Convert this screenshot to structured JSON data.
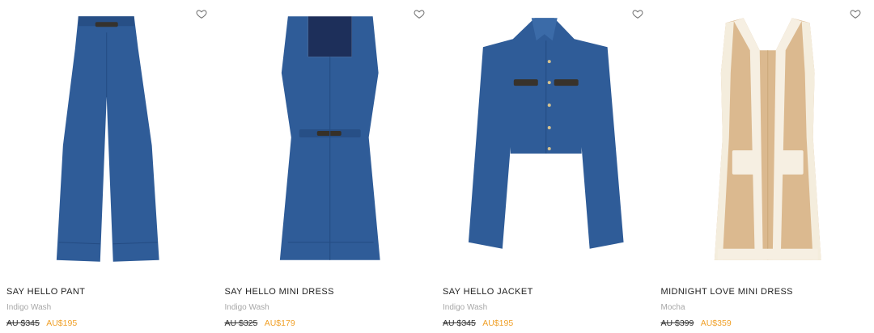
{
  "products": [
    {
      "name": "SAY HELLO PANT",
      "color": "Indigo Wash",
      "price_original": "AU $345",
      "price_sale": "AU$195",
      "image": "denim-wide-leg-pant",
      "swatch": "#2f5c98"
    },
    {
      "name": "SAY HELLO MINI DRESS",
      "color": "Indigo Wash",
      "price_original": "AU $325",
      "price_sale": "AU$179",
      "image": "denim-mini-dress",
      "swatch": "#2f5c98"
    },
    {
      "name": "SAY HELLO JACKET",
      "color": "Indigo Wash",
      "price_original": "AU $345",
      "price_sale": "AU$195",
      "image": "denim-cropped-jacket",
      "swatch": "#2f5c98"
    },
    {
      "name": "MIDNIGHT LOVE MINI DRESS",
      "color": "Mocha",
      "price_original": "AU $399",
      "price_sale": "AU$359",
      "image": "mocha-vest-dress",
      "swatch": "#dbb98f"
    }
  ],
  "icons": {
    "favorite": "heart-outline-icon"
  },
  "colors": {
    "sale": "#f0a028",
    "denim": "#2f5c98",
    "mocha": "#dbb98f",
    "cream": "#f6efe2"
  }
}
